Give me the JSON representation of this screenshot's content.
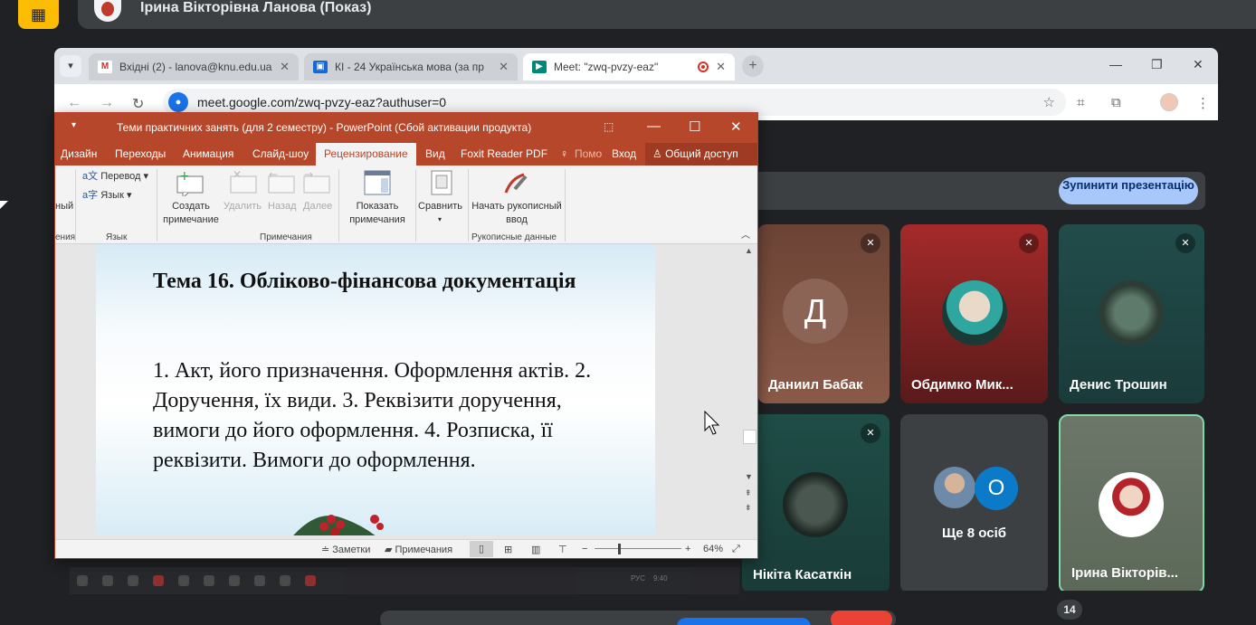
{
  "meet_top": {
    "presenter_name": "Ірина Вікторівна Ланова (Показ)"
  },
  "browser": {
    "tabs": [
      {
        "title": "Вхідні (2) - lanova@knu.edu.ua",
        "favicon": "gmail-icon",
        "active": false
      },
      {
        "title": "КІ - 24 Українська мова (за пр",
        "favicon": "classroom-icon",
        "active": false
      },
      {
        "title": "Meet: \"zwq-pvzy-eaz\"",
        "favicon": "meet-icon",
        "active": true
      }
    ],
    "url": "meet.google.com/zwq-pvzy-eaz?authuser=0"
  },
  "meet": {
    "stop_button_label": "Зупинити презентацію",
    "participants": [
      {
        "name": "Даниил Бабак",
        "initial": "Д",
        "muted": true,
        "bg": "#7a4e3e"
      },
      {
        "name": "Обдимко Мик...",
        "initial": "",
        "muted": true,
        "bg": "#8c2a2a"
      },
      {
        "name": "Денис Трошин",
        "initial": "",
        "muted": true,
        "bg": "#1f4a47"
      },
      {
        "name": "Нікіта Касаткін",
        "initial": "",
        "muted": true,
        "bg": "#1f4a44"
      },
      {
        "name": "Ще 8 осіб",
        "initial": "О",
        "muted": false,
        "bg": "#3c4043"
      },
      {
        "name": "Ірина Вікторів...",
        "initial": "",
        "muted": false,
        "bg": "#6e7a6c"
      }
    ],
    "participant_count": "14"
  },
  "ppt": {
    "window_title": "Теми практичних занять (для 2 семестру) - PowerPoint (Сбой активации продукта)",
    "ribbon_tabs": [
      "Дизайн",
      "Переходы",
      "Анимация",
      "Слайд-шоу",
      "Рецензирование",
      "Вид",
      "Foxit Reader PDF",
      "Помо",
      "Вход"
    ],
    "share_label": "Общий доступ",
    "ribbon": {
      "translate": "Перевод",
      "language": "Язык",
      "language_group": "Язык",
      "left_cut_1": "ный",
      "left_cut_2": "ения",
      "new_comment": "Создать примечание",
      "delete": "Удалить",
      "previous": "Назад",
      "next": "Далее",
      "show_comments": "Показать примечания",
      "comments_group": "Примечания",
      "compare": "Сравнить",
      "ink": "Начать рукописный ввод",
      "ink_group": "Рукописные данные"
    },
    "slide": {
      "title": "Тема 16. Обліково-фінансова документація",
      "body": "1. Акт, його призначення. Оформлення актів. 2. Доручення, їх види. 3. Реквізити доручення, вимоги до його оформлення. 4. Розписка, її реквізити. Вимоги до оформлення."
    },
    "status": {
      "notes": "Заметки",
      "comments": "Примечания",
      "zoom": "64%"
    }
  },
  "taskbar": {
    "time": "9:40",
    "lang": "РУС"
  }
}
